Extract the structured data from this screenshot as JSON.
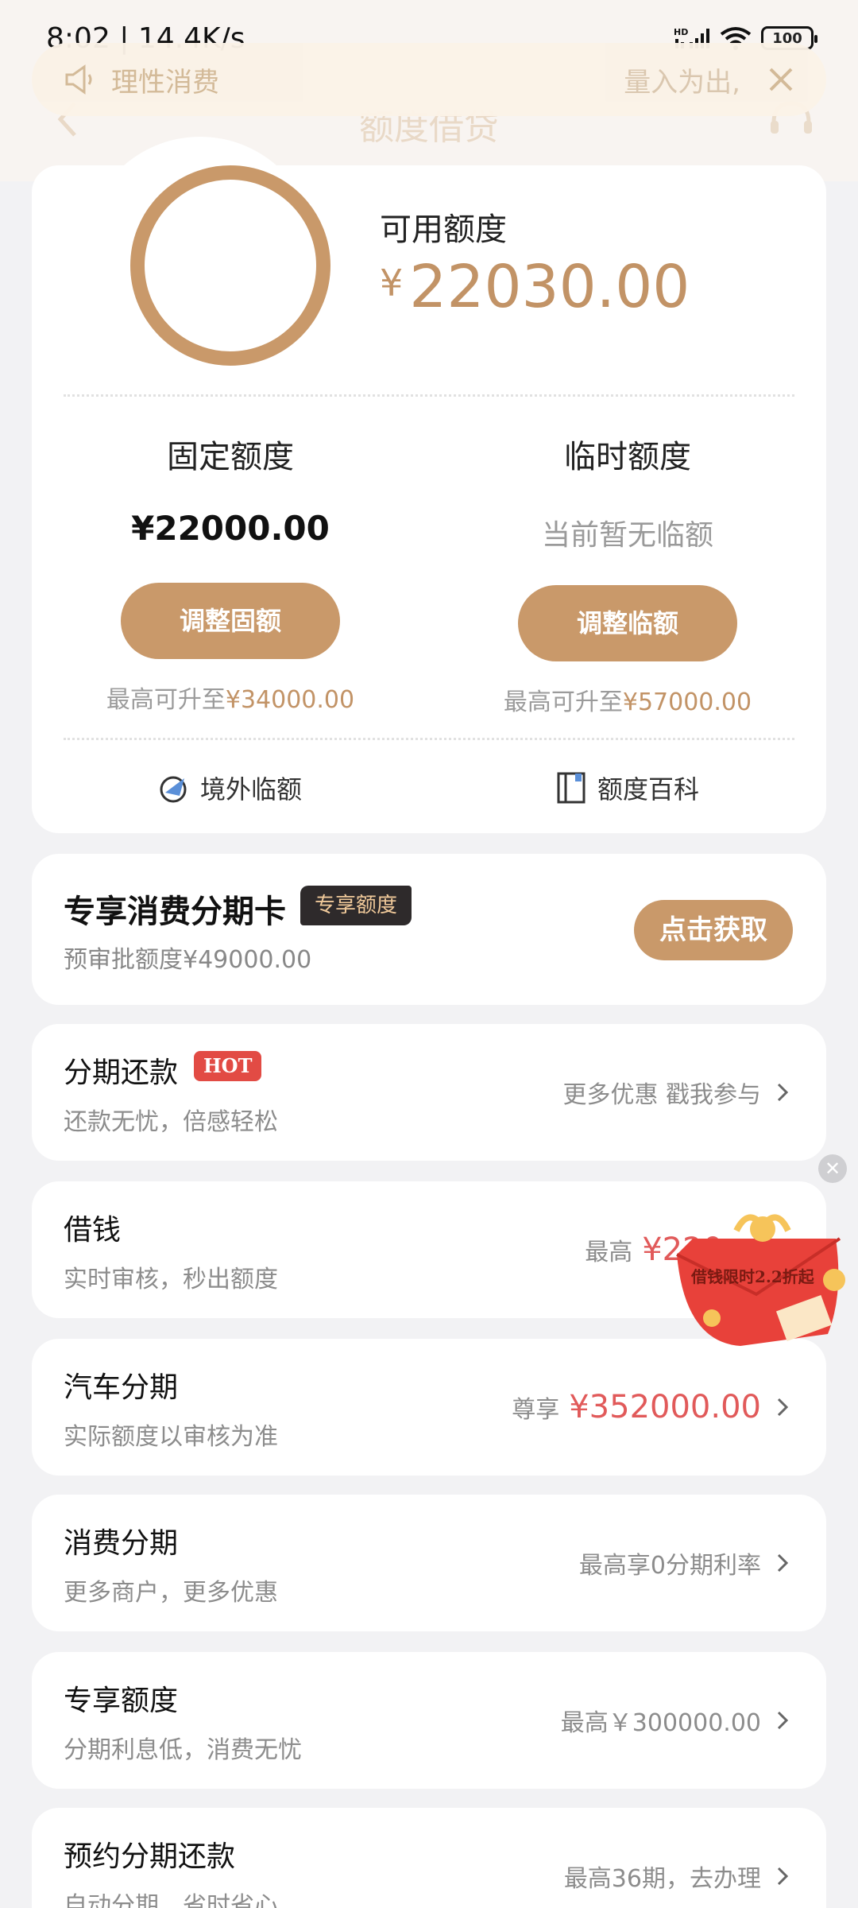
{
  "status_bar": {
    "time_speed": "8:02 | 14.4K/s",
    "battery": "100"
  },
  "nav": {
    "title": "额度借贷"
  },
  "notice": {
    "left_text": "理性消费",
    "right_text": "量入为出,"
  },
  "quota": {
    "available_label": "可用额度",
    "available_currency": "¥",
    "available_amount": "22030.00",
    "fixed": {
      "title": "固定额度",
      "value": "¥22000.00",
      "button": "调整固额",
      "hint_prefix": "最高可升至",
      "hint_amount": "¥34000.00"
    },
    "temp": {
      "title": "临时额度",
      "value": "当前暂无临额",
      "button": "调整临额",
      "hint_prefix": "最高可升至",
      "hint_amount": "¥57000.00"
    },
    "links": {
      "overseas": "境外临额",
      "wiki": "额度百科"
    }
  },
  "special": {
    "title": "专享消费分期卡",
    "tag": "专享额度",
    "sub": "预审批额度¥49000.00",
    "button": "点击获取"
  },
  "items": [
    {
      "title": "分期还款",
      "badge": "HOT",
      "sub": "还款无忧，倍感轻松",
      "right_prefix": "",
      "right_text": "更多优惠 戳我参与"
    },
    {
      "title": "借钱",
      "sub": "实时审核，秒出额度",
      "right_prefix": "最高",
      "right_text": "¥220"
    },
    {
      "title": "汽车分期",
      "sub": "实际额度以审核为准",
      "right_prefix": "尊享",
      "right_text": "¥352000.00"
    },
    {
      "title": "消费分期",
      "sub": "更多商户，更多优惠",
      "right_prefix": "",
      "right_text": "最高享0分期利率"
    },
    {
      "title": "专享额度",
      "sub": "分期利息低，消费无忧",
      "right_prefix": "",
      "right_text": "最高￥300000.00"
    },
    {
      "title": "预约分期还款",
      "sub": "自动分期，省时省心",
      "right_prefix": "",
      "right_text": "最高36期，去办理"
    }
  ],
  "promo": {
    "text": "借钱限时2.2折起"
  },
  "colors": {
    "gold": "#c9996a",
    "gold_text": "#c29366",
    "red": "#e15a5a"
  }
}
